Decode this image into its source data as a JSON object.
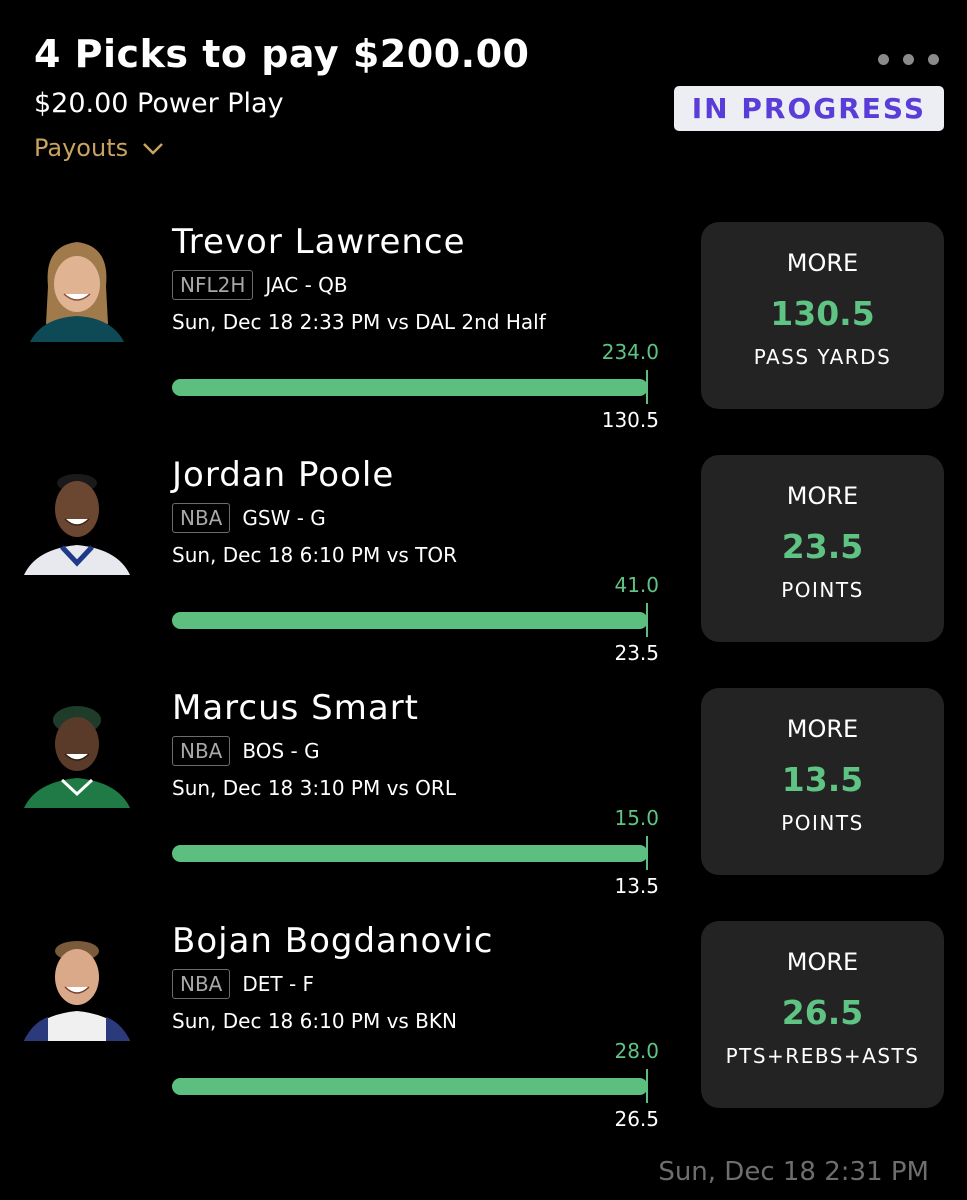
{
  "header": {
    "title": "4 Picks to pay $200.00",
    "subtitle": "$20.00 Power Play",
    "payouts_label": "Payouts",
    "status": "IN PROGRESS"
  },
  "colors": {
    "accent_green": "#5fc483",
    "status_text": "#5a3cd8",
    "payouts_gold": "#c9a45e"
  },
  "picks": [
    {
      "player": "Trevor Lawrence",
      "league": "NFL2H",
      "team_pos": "JAC - QB",
      "game": "Sun, Dec 18 2:33 PM  vs DAL 2nd Half",
      "current": "234.0",
      "line": "130.5",
      "progress": 1.0,
      "direction": "MORE",
      "stat": "PASS YARDS"
    },
    {
      "player": "Jordan Poole",
      "league": "NBA",
      "team_pos": "GSW - G",
      "game": "Sun, Dec 18 6:10 PM  vs TOR",
      "current": "41.0",
      "line": "23.5",
      "progress": 1.0,
      "direction": "MORE",
      "stat": "POINTS"
    },
    {
      "player": "Marcus Smart",
      "league": "NBA",
      "team_pos": "BOS - G",
      "game": "Sun, Dec 18 3:10 PM  vs ORL",
      "current": "15.0",
      "line": "13.5",
      "progress": 1.0,
      "direction": "MORE",
      "stat": "POINTS"
    },
    {
      "player": "Bojan Bogdanovic",
      "league": "NBA",
      "team_pos": "DET - F",
      "game": "Sun, Dec 18 6:10 PM  vs BKN",
      "current": "28.0",
      "line": "26.5",
      "progress": 1.0,
      "direction": "MORE",
      "stat": "PTS+REBS+ASTS"
    }
  ],
  "footer": {
    "timestamp": "Sun, Dec 18 2:31 PM"
  }
}
